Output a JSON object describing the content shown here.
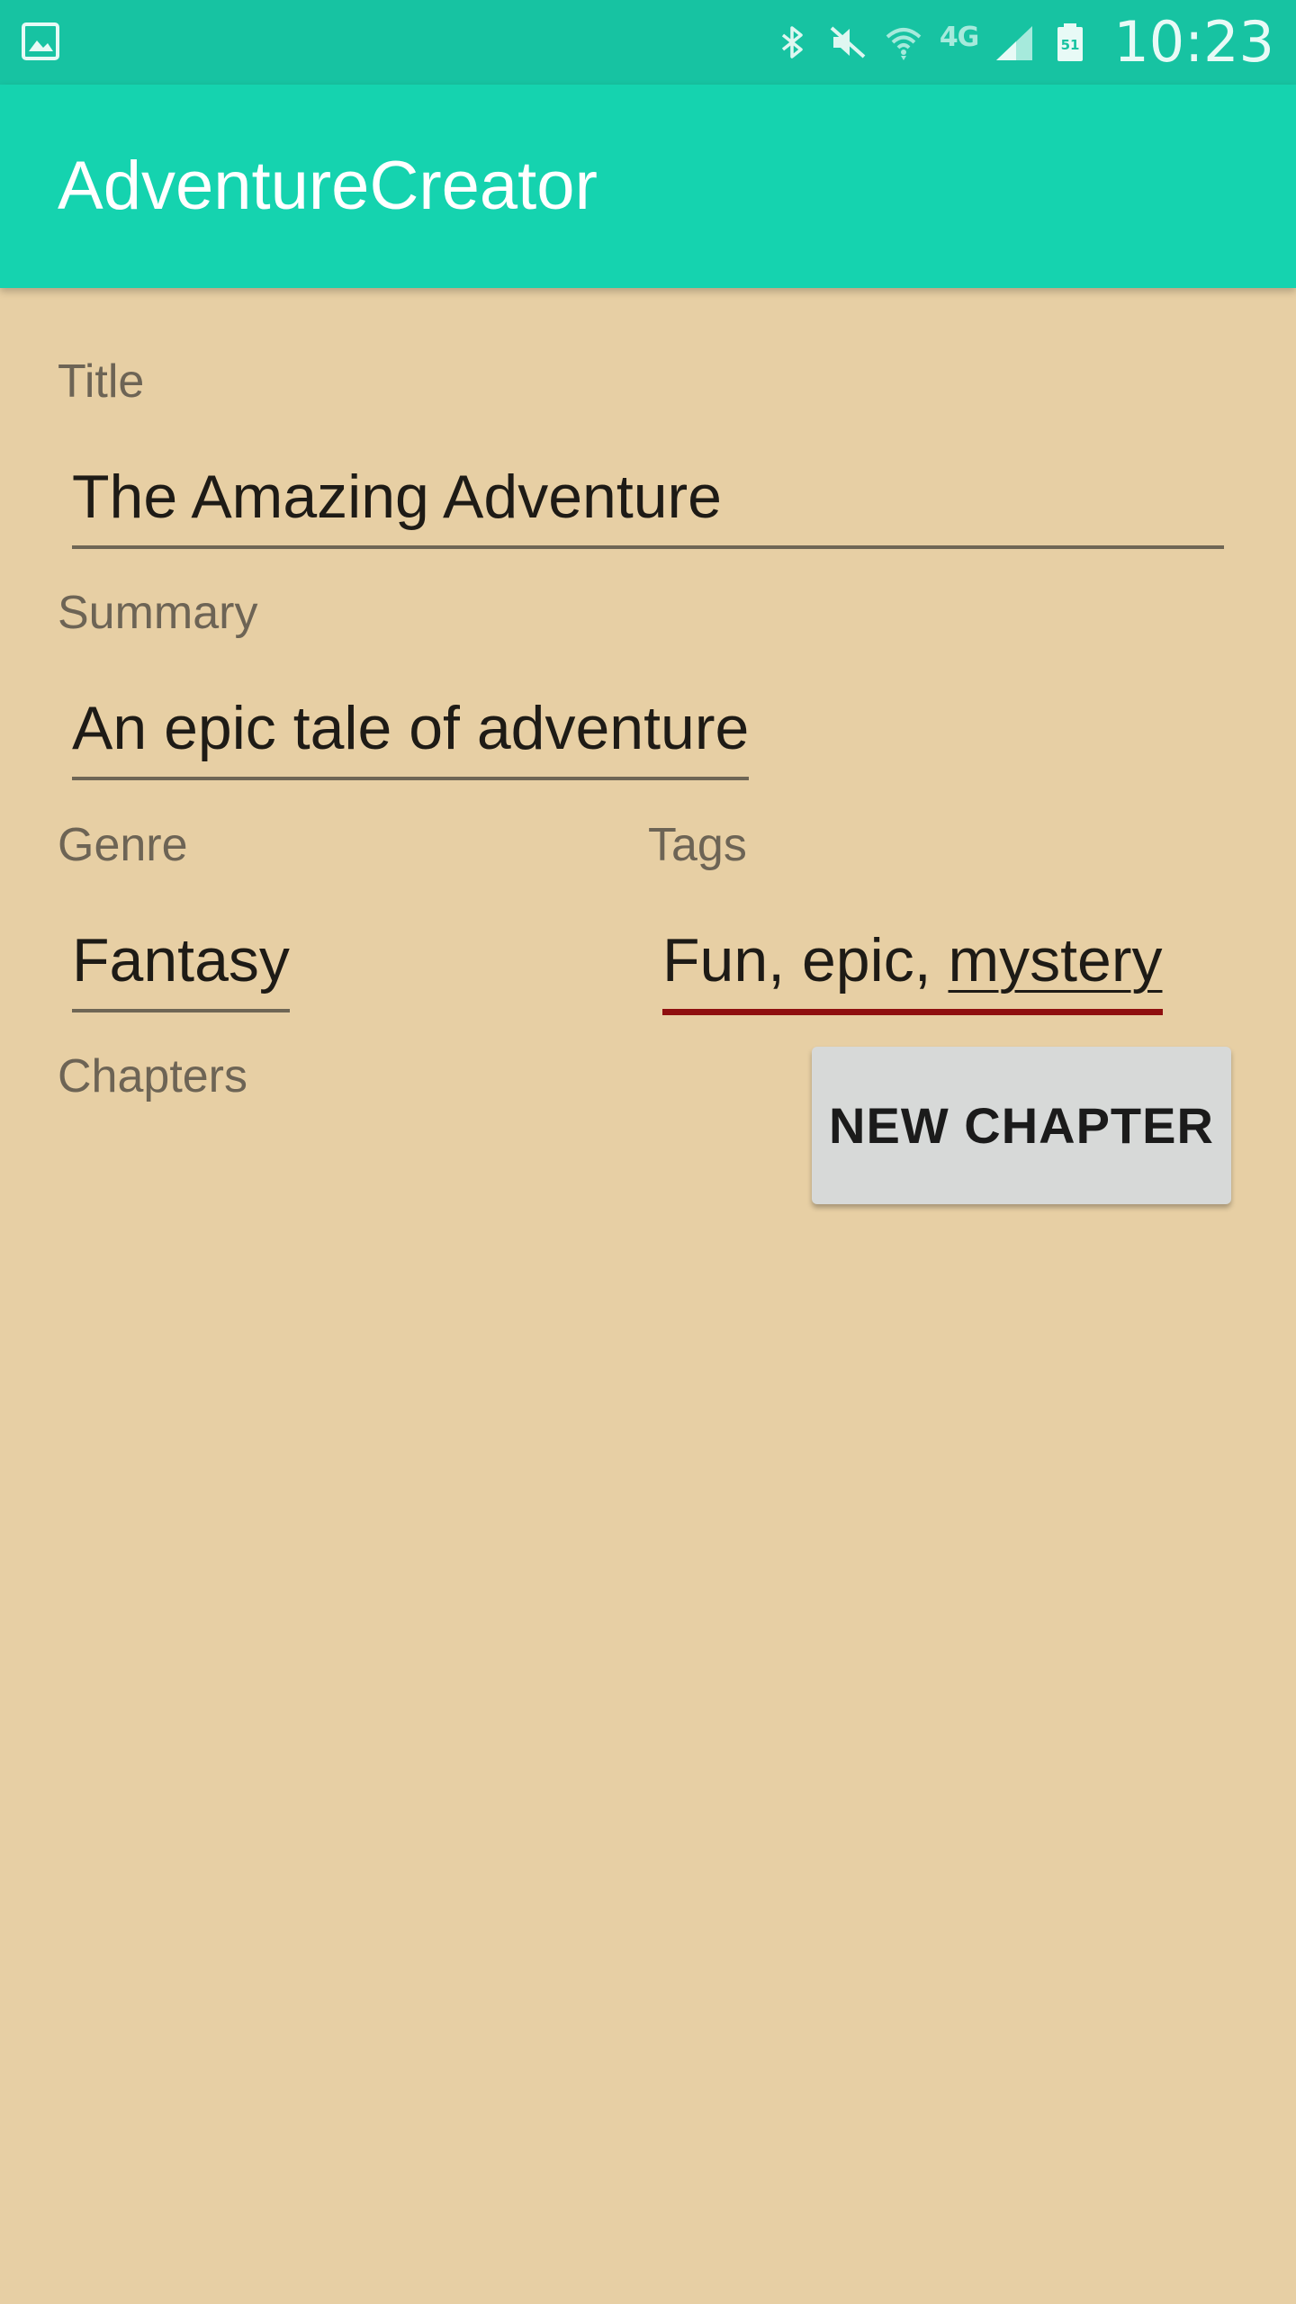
{
  "status_bar": {
    "time": "10:23",
    "network_type": "4G",
    "battery_level": "51",
    "icons": [
      "gallery-icon",
      "bluetooth-icon",
      "mute-icon",
      "wifi-icon",
      "signal-icon",
      "battery-icon"
    ]
  },
  "app_bar": {
    "title": "AdventureCreator"
  },
  "form": {
    "title_label": "Title",
    "title_value": "The Amazing Adventure",
    "summary_label": "Summary",
    "summary_value": "An epic tale of adventure",
    "genre_label": "Genre",
    "genre_value": "Fantasy",
    "tags_label": "Tags",
    "tags_value_committed": "Fun, epic, ",
    "tags_value_composing": "mystery",
    "chapters_label": "Chapters",
    "new_chapter_button": "NEW CHAPTER"
  },
  "colors": {
    "status_bar": "#17c3a2",
    "app_bar": "#15d3af",
    "background": "#e7cfa4",
    "focused_underline": "#8f0f0f",
    "button": "#d7d9d8"
  }
}
